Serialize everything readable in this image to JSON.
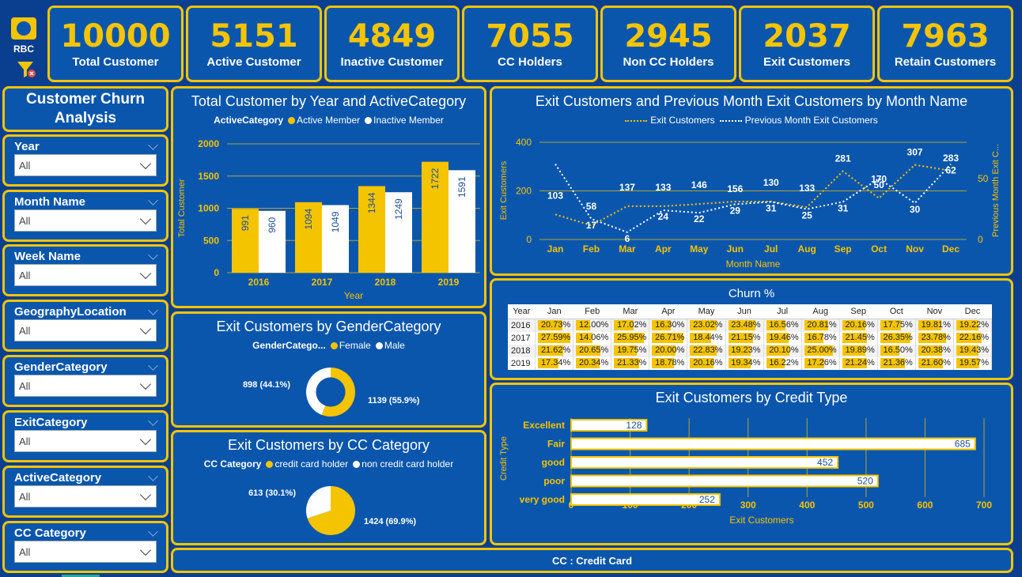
{
  "brand": {
    "logo_text": "RBC"
  },
  "kpis": [
    {
      "value": "10000",
      "label": "Total Customer"
    },
    {
      "value": "5151",
      "label": "Active Customer"
    },
    {
      "value": "4849",
      "label": "Inactive Customer"
    },
    {
      "value": "7055",
      "label": "CC Holders"
    },
    {
      "value": "2945",
      "label": "Non CC Holders"
    },
    {
      "value": "2037",
      "label": "Exit Customers"
    },
    {
      "value": "7963",
      "label": "Retain Customers"
    }
  ],
  "sidebar": {
    "title": "Customer Churn Analysis",
    "slicers": [
      {
        "label": "Year",
        "value": "All"
      },
      {
        "label": "Month Name",
        "value": "All"
      },
      {
        "label": "Week Name",
        "value": "All"
      },
      {
        "label": "GeographyLocation",
        "value": "All"
      },
      {
        "label": "GenderCategory",
        "value": "All"
      },
      {
        "label": "ExitCategory",
        "value": "All"
      },
      {
        "label": "ActiveCategory",
        "value": "All"
      },
      {
        "label": "CC Category",
        "value": "All"
      }
    ]
  },
  "colors": {
    "accent": "#f5c400",
    "panel": "#0a56ad",
    "background": "#0a3f8f"
  },
  "footer": {
    "note": "CC : Credit Card"
  },
  "chart_data": [
    {
      "id": "year_active",
      "type": "bar",
      "title": "Total Customer by Year and ActiveCategory",
      "legend_title": "ActiveCategory",
      "categories": [
        "2016",
        "2017",
        "2018",
        "2019"
      ],
      "series": [
        {
          "name": "Active Member",
          "color": "#f5c400",
          "values": [
            991,
            1094,
            1344,
            1722
          ]
        },
        {
          "name": "Inactive Member",
          "color": "#ffffff",
          "values": [
            960,
            1049,
            1249,
            1591
          ]
        }
      ],
      "xlabel": "Year",
      "ylabel": "Total Customer",
      "yticks": [
        "0",
        "500",
        "1000",
        "1500",
        "2000"
      ],
      "ylim": [
        0,
        2000
      ]
    },
    {
      "id": "exit_month",
      "type": "line",
      "title": "Exit Customers and Previous Month Exit Customers by Month Name",
      "categories": [
        "Jan",
        "Feb",
        "Mar",
        "Apr",
        "May",
        "Jun",
        "Jul",
        "Aug",
        "Sep",
        "Oct",
        "Nov",
        "Dec"
      ],
      "series": [
        {
          "name": "Exit Customers",
          "color": "#f5c400",
          "values": [
            103,
            58,
            137,
            137,
            146,
            156,
            156,
            133,
            281,
            170,
            307,
            283
          ]
        },
        {
          "name": "Previous Month Exit Customers",
          "color": "#ffffff",
          "axis": "right",
          "values": [
            62,
            17,
            6,
            24,
            22,
            29,
            31,
            25,
            31,
            50,
            30,
            62
          ]
        }
      ],
      "labels_left": [
        "103",
        "58",
        "137",
        "133",
        "146",
        "156",
        "130",
        "133",
        "281",
        "170",
        "307",
        "283"
      ],
      "labels_right": [
        "",
        "17",
        "6",
        "24",
        "22",
        "29",
        "31",
        "25",
        "31",
        "50",
        "30",
        "62"
      ],
      "xlabel": "Month Name",
      "ylabel": "Exit Customers",
      "y2label": "Previous Month Exit C...",
      "yticks": [
        "0",
        "200",
        "400"
      ],
      "y2ticks": [
        "0",
        "50"
      ],
      "ylim": [
        0,
        400
      ],
      "y2lim": [
        0,
        80
      ]
    },
    {
      "id": "gender",
      "type": "pie",
      "title": "Exit Customers by GenderCategory",
      "legend_title": "GenderCatego...",
      "slices": [
        {
          "name": "Female",
          "value": 1139,
          "label": "1139 (55.9%)",
          "color": "#f5c400"
        },
        {
          "name": "Male",
          "value": 898,
          "label": "898 (44.1%)",
          "color": "#ffffff"
        }
      ],
      "donut": true
    },
    {
      "id": "cc",
      "type": "pie",
      "title": "Exit Customers by CC Category",
      "legend_title": "CC Category",
      "slices": [
        {
          "name": "credit card holder",
          "value": 1424,
          "label": "1424 (69.9%)",
          "color": "#f5c400"
        },
        {
          "name": "non credit card holder",
          "value": 613,
          "label": "613 (30.1%)",
          "color": "#ffffff"
        }
      ],
      "donut": false
    },
    {
      "id": "churn",
      "type": "table",
      "title": "Churn %",
      "columns": [
        "Year",
        "Jan",
        "Feb",
        "Mar",
        "Apr",
        "May",
        "Jun",
        "Jul",
        "Aug",
        "Sep",
        "Oct",
        "Nov",
        "Dec"
      ],
      "rows": [
        [
          "2016",
          "20.73%",
          "12.00%",
          "17.02%",
          "16.30%",
          "23.02%",
          "23.48%",
          "16.56%",
          "20.81%",
          "20.16%",
          "17.75%",
          "19.81%",
          "19.22%"
        ],
        [
          "2017",
          "27.59%",
          "14.06%",
          "25.95%",
          "26.71%",
          "18.44%",
          "21.15%",
          "19.46%",
          "16.78%",
          "21.45%",
          "26.35%",
          "23.78%",
          "22.16%"
        ],
        [
          "2018",
          "21.62%",
          "20.65%",
          "19.75%",
          "20.00%",
          "22.83%",
          "19.23%",
          "20.10%",
          "25.00%",
          "19.89%",
          "16.50%",
          "20.38%",
          "19.43%"
        ],
        [
          "2019",
          "17.34%",
          "20.34%",
          "21.33%",
          "18.78%",
          "20.16%",
          "19.34%",
          "16.22%",
          "17.26%",
          "21.24%",
          "21.36%",
          "21.60%",
          "19.57%"
        ]
      ]
    },
    {
      "id": "credit",
      "type": "bar",
      "orientation": "horizontal",
      "title": "Exit Customers by Credit Type",
      "categories": [
        "Excellent",
        "Fair",
        "good",
        "poor",
        "very good"
      ],
      "values": [
        128,
        685,
        452,
        520,
        252
      ],
      "xlabel": "Exit Customers",
      "ylabel": "Credit Type",
      "xticks": [
        "0",
        "100",
        "200",
        "300",
        "400",
        "500",
        "600",
        "700"
      ],
      "xlim": [
        0,
        700
      ]
    }
  ]
}
